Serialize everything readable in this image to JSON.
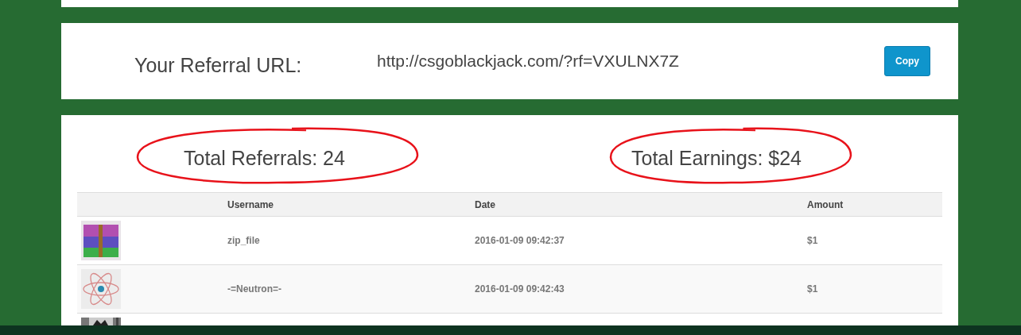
{
  "referral": {
    "label": "Your Referral URL:",
    "url": "http://csgoblackjack.com/?rf=VXULNX7Z",
    "button": "Copy"
  },
  "stats": [
    {
      "label": "Total Referrals: 24",
      "circled": true
    },
    {
      "label": "Total Earnings: $24",
      "circled": true
    }
  ],
  "table": {
    "columns": [
      "Username",
      "Date",
      "Amount"
    ],
    "rows": [
      {
        "avatar": {
          "kind": "archive"
        },
        "username": "zip_file",
        "date": "2016-01-09 09:42:37",
        "amount": "$1"
      },
      {
        "avatar": {
          "kind": "atom"
        },
        "username": "-=Neutron=-",
        "date": "2016-01-09 09:42:43",
        "amount": "$1"
      },
      {
        "avatar": {
          "kind": "picture"
        }
      }
    ]
  }
}
